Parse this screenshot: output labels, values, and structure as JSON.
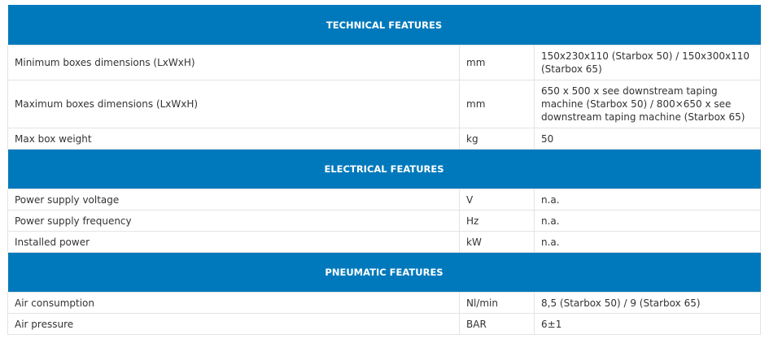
{
  "sections": [
    {
      "title": "TECHNICAL FEATURES",
      "rows": [
        {
          "name": "Minimum boxes dimensions (LxWxH)",
          "unit": "mm",
          "value": "150x230x110 (Starbox 50) / 150x300x110 (Starbox 65)"
        },
        {
          "name": "Maximum boxes dimensions (LxWxH)",
          "unit": "mm",
          "value": "650 x 500 x see downstream taping machine (Starbox 50) / 800×650 x see downstream taping machine (Starbox 65)"
        },
        {
          "name": "Max box weight",
          "unit": "kg",
          "value": "50"
        }
      ]
    },
    {
      "title": "ELECTRICAL FEATURES",
      "rows": [
        {
          "name": "Power supply voltage",
          "unit": "V",
          "value": "n.a."
        },
        {
          "name": "Power supply frequency",
          "unit": "Hz",
          "value": "n.a."
        },
        {
          "name": "Installed power",
          "unit": "kW",
          "value": "n.a."
        }
      ]
    },
    {
      "title": "PNEUMATIC FEATURES",
      "rows": [
        {
          "name": "Air consumption",
          "unit": "Nl/min",
          "value": "8,5 (Starbox 50) / 9 (Starbox 65)"
        },
        {
          "name": "Air pressure",
          "unit": "BAR",
          "value": "6±1"
        }
      ]
    }
  ],
  "colors": {
    "section_header_bg": "#0079bc",
    "section_header_text": "#ffffff",
    "cell_text": "#333333",
    "border": "#e3e3e3"
  }
}
